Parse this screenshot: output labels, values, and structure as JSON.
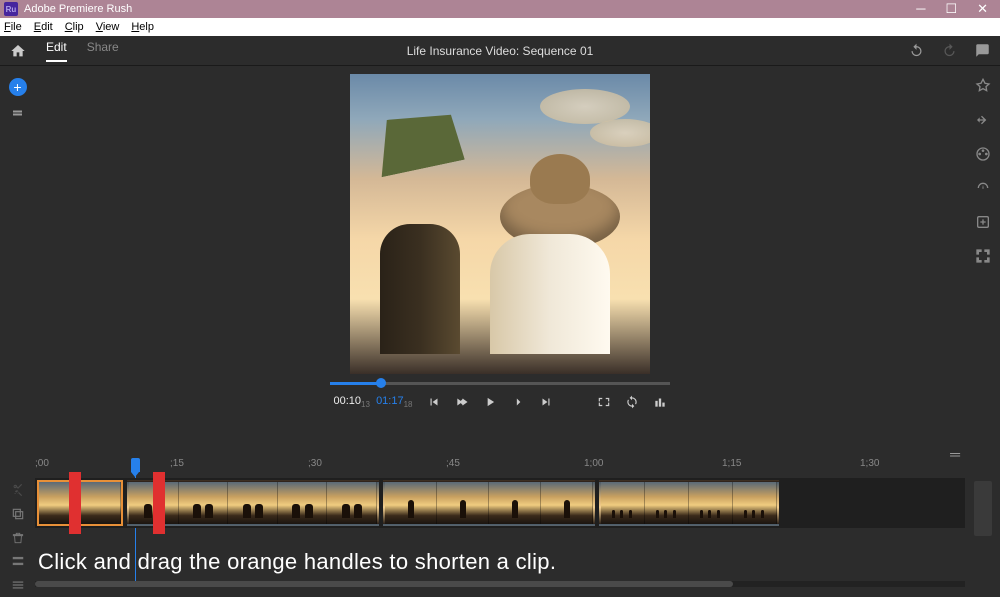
{
  "titlebar": {
    "app_name": "Adobe Premiere Rush",
    "app_badge": "Ru"
  },
  "menubar": {
    "file": "File",
    "edit": "Edit",
    "clip": "Clip",
    "view": "View",
    "help": "Help"
  },
  "topnav": {
    "tab_edit": "Edit",
    "tab_share": "Share",
    "project_title": "Life Insurance Video: Sequence 01"
  },
  "transport": {
    "current": "00:10",
    "current_frames": "13",
    "duration": "01:17",
    "duration_frames": "18"
  },
  "ruler": {
    "t0": ";00",
    "t1": ";15",
    "t2": ";30",
    "t3": ";45",
    "t4": "1;00",
    "t5": "1;15",
    "t6": "1;30"
  },
  "instruction": "Click and drag the orange handles to shorten a clip."
}
